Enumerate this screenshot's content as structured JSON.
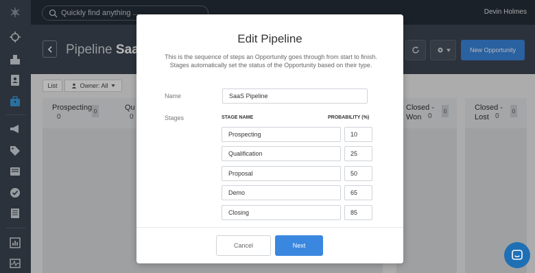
{
  "topbar": {
    "search_placeholder": "Quickly find anything ...",
    "user_name": "Devin Holmes"
  },
  "sidebar": {
    "icons": [
      "logo-icon",
      "crosshair-icon",
      "building-icon",
      "contact-card-icon",
      "briefcase-icon",
      "megaphone-icon",
      "tag-icon",
      "inbox-icon",
      "check-circle-icon",
      "document-icon",
      "bar-chart-icon",
      "activity-icon"
    ],
    "active_icon": "briefcase-icon"
  },
  "header": {
    "title_prefix": "Pipeline",
    "title_name": "SaaS",
    "new_opportunity_label": "New Opportunity"
  },
  "toolbar": {
    "list_label": "List",
    "owner_label": "Owner: All"
  },
  "board": {
    "columns": [
      {
        "title": "Prospecting",
        "count": "0",
        "badge": "0"
      },
      {
        "title": "Qu",
        "count": "0",
        "badge": ""
      },
      {
        "title": "Closed -\nWon",
        "count": "0",
        "badge": "0"
      },
      {
        "title": "Closed -\nLost",
        "count": "0",
        "badge": "0"
      }
    ]
  },
  "modal": {
    "title": "Edit Pipeline",
    "description": "This is the sequence of steps an Opportunity goes through from start to finish. Stages automatically set the status of the Opportunity based on their type.",
    "name_label": "Name",
    "name_value": "SaaS Pipeline",
    "stages_label": "Stages",
    "stage_name_header": "STAGE NAME",
    "probability_header": "PROBABILITY (%)",
    "stages": [
      {
        "name": "Prospecting",
        "probability": "10"
      },
      {
        "name": "Qualification",
        "probability": "25"
      },
      {
        "name": "Proposal",
        "probability": "50"
      },
      {
        "name": "Demo",
        "probability": "65"
      },
      {
        "name": "Closing",
        "probability": "85"
      }
    ],
    "cancel_label": "Cancel",
    "next_label": "Next"
  },
  "colors": {
    "sidebar_bg": "#3d4653",
    "topbar_bg": "#262e38",
    "accent_blue": "#3a87e0",
    "chat_blue": "#1f6fb5"
  }
}
